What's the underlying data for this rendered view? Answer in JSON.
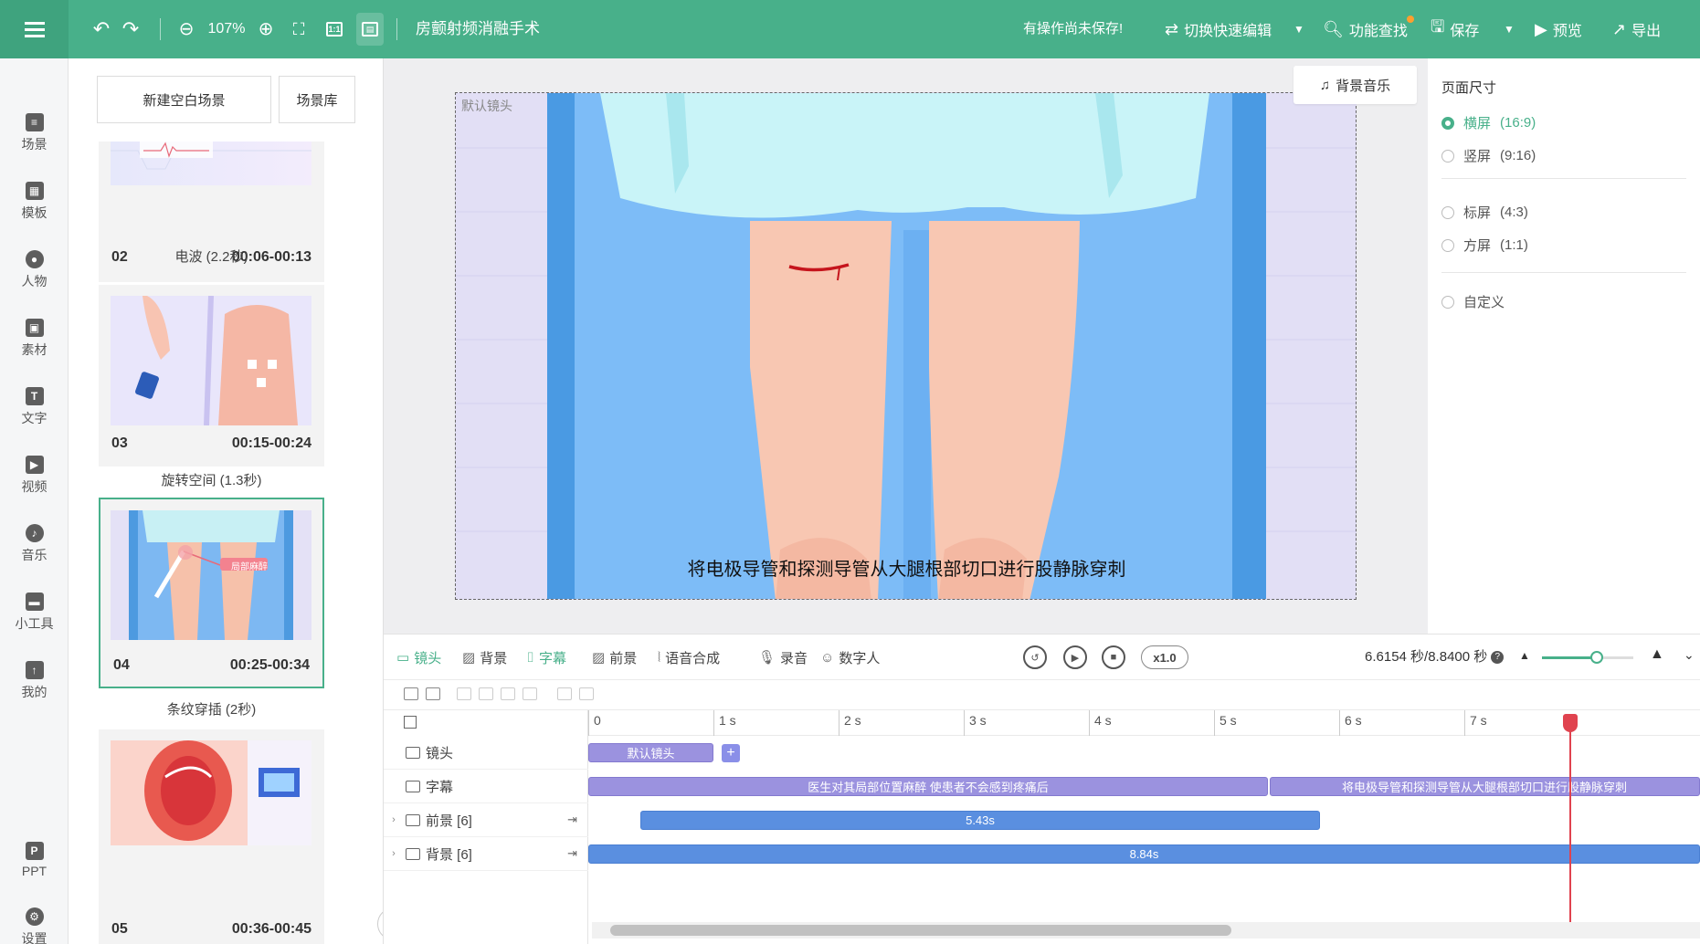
{
  "header": {
    "zoom": "107%",
    "title": "房颤射频消融手术",
    "unsaved": "有操作尚未保存!",
    "switch_edit": "切换快速编辑",
    "find": "功能查找",
    "save": "保存",
    "preview": "预览",
    "export": "导出"
  },
  "nav": {
    "items": [
      {
        "label": "场景"
      },
      {
        "label": "模板"
      },
      {
        "label": "人物"
      },
      {
        "label": "素材"
      },
      {
        "label": "文字"
      },
      {
        "label": "视频"
      },
      {
        "label": "音乐"
      },
      {
        "label": "小工具"
      },
      {
        "label": "我的"
      },
      {
        "label": "PPT"
      },
      {
        "label": "设置"
      }
    ]
  },
  "scenes": {
    "new_blank": "新建空白场景",
    "library": "场景库",
    "cards": [
      {
        "num": "02",
        "time": "00:06-00:13",
        "transition": "电波 (2.2秒)"
      },
      {
        "num": "03",
        "time": "00:15-00:24",
        "transition": "旋转空间 (1.3秒)"
      },
      {
        "num": "04",
        "time": "00:25-00:34",
        "transition": "条纹穿插 (2秒)",
        "badge": "局部麻醉"
      },
      {
        "num": "05",
        "time": "00:36-00:45"
      }
    ]
  },
  "canvas": {
    "label": "默认镜头",
    "subtitle": "将电极导管和探测导管从大腿根部切口进行股静脉穿刺",
    "bgm": "背景音乐"
  },
  "page_size": {
    "title": "页面尺寸",
    "options": [
      {
        "label": "横屏",
        "ratio": "(16:9)",
        "selected": true
      },
      {
        "label": "竖屏",
        "ratio": "(9:16)",
        "selected": false
      },
      {
        "label": "标屏",
        "ratio": "(4:3)",
        "selected": false
      },
      {
        "label": "方屏",
        "ratio": "(1:1)",
        "selected": false
      },
      {
        "label": "自定义",
        "ratio": "",
        "selected": false
      }
    ]
  },
  "timeline": {
    "tabs": [
      {
        "label": "镜头",
        "icon": "camera-icon",
        "active": true
      },
      {
        "label": "背景",
        "icon": "hatch-icon",
        "active": false
      },
      {
        "label": "字幕",
        "icon": "caption-icon",
        "active": true
      },
      {
        "label": "前景",
        "icon": "hatch-icon",
        "active": false
      },
      {
        "label": "语音合成",
        "icon": "voice-icon",
        "active": false
      },
      {
        "label": "录音",
        "icon": "mic-icon",
        "active": false
      },
      {
        "label": "数字人",
        "icon": "digital-human-icon",
        "active": false
      }
    ],
    "speed": "x1.0",
    "time_readout": "6.6154 秒/8.8400 秒",
    "zoom_level": 0.6,
    "ruler": [
      "0",
      "1 s",
      "2 s",
      "3 s",
      "4 s",
      "5 s",
      "6 s",
      "7 s"
    ],
    "tracks": [
      {
        "label": "镜头",
        "expandable": false
      },
      {
        "label": "字幕",
        "expandable": false
      },
      {
        "label": "前景 [6]",
        "expandable": true
      },
      {
        "label": "背景 [6]",
        "expandable": true
      }
    ],
    "clips": {
      "shot": "默认镜头",
      "caption1": "医生对其局部位置麻醉  使患者不会感到疼痛后",
      "caption2": "将电极导管和探测导管从大腿根部切口进行股静脉穿刺",
      "foreground": "5.43s",
      "background": "8.84s"
    },
    "playhead_seconds": 6.6154
  },
  "colors": {
    "brand": "#48b08a",
    "clip_purple": "#9b92df",
    "clip_blue": "#5a8fe0",
    "playhead": "#e0434f"
  }
}
